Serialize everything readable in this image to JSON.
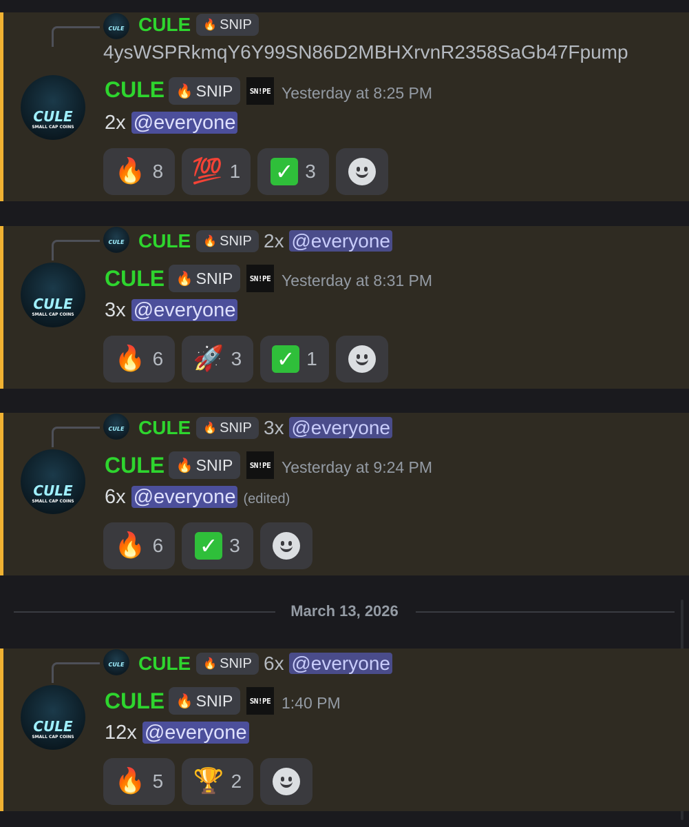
{
  "messages": [
    {
      "reply": {
        "username": "CULE",
        "tag": "SNIP",
        "text": "4ysWSPRkmqY6Y99SN86D2MBHXrvnR2358SaGb47Fpump",
        "mention": ""
      },
      "username": "CULE",
      "tag": "SNIP",
      "badge": "SNIPE",
      "timestamp": "Yesterday at 8:25 PM",
      "text": "2x",
      "mention": "@everyone",
      "edited": "",
      "reactions": [
        {
          "emoji": "🔥",
          "count": "8"
        },
        {
          "emoji": "💯",
          "count": "1"
        },
        {
          "emoji": "check",
          "count": "3"
        }
      ]
    },
    {
      "reply": {
        "username": "CULE",
        "tag": "SNIP",
        "text": "2x",
        "mention": "@everyone"
      },
      "username": "CULE",
      "tag": "SNIP",
      "badge": "SNIPE",
      "timestamp": "Yesterday at 8:31 PM",
      "text": "3x",
      "mention": "@everyone",
      "edited": "",
      "reactions": [
        {
          "emoji": "🔥",
          "count": "6"
        },
        {
          "emoji": "🚀",
          "count": "3"
        },
        {
          "emoji": "check",
          "count": "1"
        }
      ]
    },
    {
      "reply": {
        "username": "CULE",
        "tag": "SNIP",
        "text": "3x",
        "mention": "@everyone"
      },
      "username": "CULE",
      "tag": "SNIP",
      "badge": "SNIPE",
      "timestamp": "Yesterday at 9:24 PM",
      "text": "6x",
      "mention": "@everyone",
      "edited": "(edited)",
      "reactions": [
        {
          "emoji": "🔥",
          "count": "6"
        },
        {
          "emoji": "check",
          "count": "3"
        }
      ]
    },
    {
      "reply": {
        "username": "CULE",
        "tag": "SNIP",
        "text": "6x",
        "mention": "@everyone"
      },
      "username": "CULE",
      "tag": "SNIP",
      "badge": "SNIPE",
      "timestamp": "1:40 PM",
      "text": "12x",
      "mention": "@everyone",
      "edited": "",
      "reactions": [
        {
          "emoji": "🔥",
          "count": "5"
        },
        {
          "emoji": "🏆",
          "count": "2"
        }
      ]
    }
  ],
  "date_divider": "March 13, 2026",
  "avatar_text": {
    "main": "CULE",
    "sub": "SMALL CAP COINS"
  },
  "colors": {
    "username": "#2ed52e",
    "accent_bar": "#f0b232",
    "mention_bg": "#4c4f9b",
    "message_bg": "#2f2b22"
  }
}
